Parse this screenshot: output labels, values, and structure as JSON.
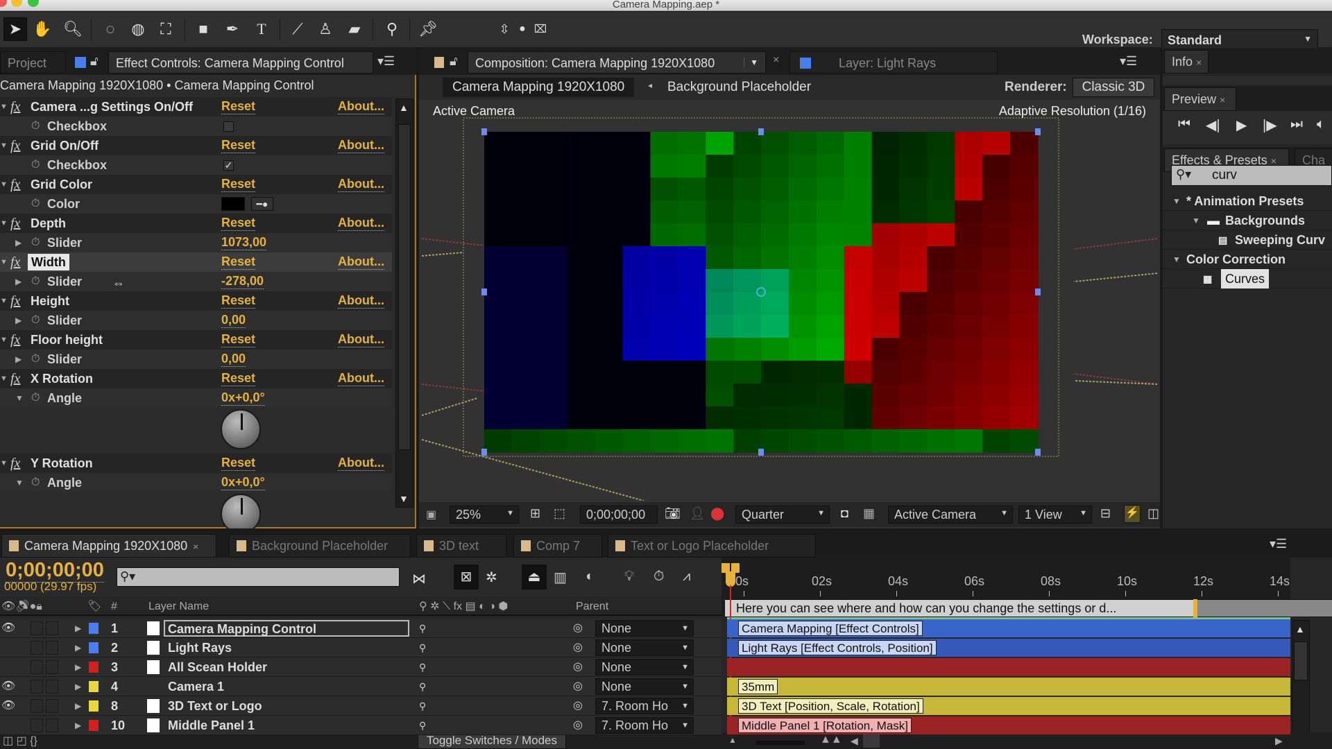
{
  "window": {
    "title": "Camera Mapping.aep *"
  },
  "toolbar": {
    "tools": [
      "selection-tool",
      "hand-tool",
      "zoom-tool",
      "rotation-tool",
      "orbit-camera-tool",
      "track-xy-camera-tool",
      "rectangle-tool",
      "pen-tool",
      "type-tool",
      "brush-tool",
      "clone-stamp-tool",
      "eraser-tool",
      "roto-brush-tool",
      "puppet-pin-tool"
    ],
    "workspace_label": "Workspace:",
    "workspace_value": "Standard"
  },
  "effect_controls": {
    "tab_project": "Project",
    "tab_title": "Effect Controls: Camera Mapping Control",
    "breadcrumb": "Camera Mapping 1920X1080 • Camera Mapping Control",
    "reset_label": "Reset",
    "about_label": "About...",
    "effects": [
      {
        "name": "Camera ...g Settings On/Off",
        "param": "Checkbox",
        "type": "checkbox",
        "checked": false
      },
      {
        "name": "Grid On/Off",
        "param": "Checkbox",
        "type": "checkbox",
        "checked": true
      },
      {
        "name": "Grid Color",
        "param": "Color",
        "type": "color",
        "color": "#000000"
      },
      {
        "name": "Depth",
        "param": "Slider",
        "type": "slider",
        "value": "1073,00"
      },
      {
        "name": "Width",
        "param": "Slider",
        "type": "slider",
        "value": "-278,00",
        "selected": true
      },
      {
        "name": "Height",
        "param": "Slider",
        "type": "slider",
        "value": "0,00"
      },
      {
        "name": "Floor height",
        "param": "Slider",
        "type": "slider",
        "value": "0,00"
      },
      {
        "name": "X Rotation",
        "param": "Angle",
        "type": "angle",
        "value": "0x+0,0°"
      },
      {
        "name": "Y Rotation",
        "param": "Angle",
        "type": "angle",
        "value": "0x+0,0°"
      }
    ]
  },
  "composition": {
    "tab_title": "Composition: Camera Mapping 1920X1080",
    "layer_tab": "Layer: Light Rays",
    "flow_current": "Camera Mapping 1920X1080",
    "flow_next": "Background Placeholder",
    "renderer_label": "Renderer:",
    "renderer_value": "Classic 3D",
    "view_label": "Active Camera",
    "adaptive_label": "Adaptive Resolution (1/16)",
    "zoom": "25%",
    "timecode": "0;00;00;00",
    "resolution": "Quarter",
    "camera_view": "Active Camera",
    "views": "1 View"
  },
  "right_panels": {
    "info_tab": "Info",
    "preview_tab": "Preview",
    "effects_tab": "Effects & Presets",
    "char_tab": "Cha",
    "search_value": "curv",
    "tree": [
      {
        "label": "* Animation Presets",
        "level": 0,
        "expanded": true
      },
      {
        "label": "Backgrounds",
        "level": 1,
        "expanded": true,
        "icon": "folder"
      },
      {
        "label": "Sweeping Curv",
        "level": 2,
        "icon": "preset"
      },
      {
        "label": "Color Correction",
        "level": 0,
        "expanded": true
      },
      {
        "label": "Curves",
        "level": 1,
        "icon": "effect-32",
        "selected": true
      }
    ]
  },
  "timeline": {
    "tabs": [
      {
        "label": "Camera Mapping 1920X1080",
        "active": true
      },
      {
        "label": "Background Placeholder"
      },
      {
        "label": "3D text"
      },
      {
        "label": "Comp 7"
      },
      {
        "label": "Text or Logo Placeholder"
      }
    ],
    "timecode": "0;00;00;00",
    "frame_info": "00000 (29.97 fps)",
    "col_num": "#",
    "col_layer_name": "Layer Name",
    "col_parent": "Parent",
    "ruler": [
      "0s",
      "02s",
      "04s",
      "06s",
      "08s",
      "10s",
      "12s",
      "14s"
    ],
    "comment": "Here you can see where and how can you change the settings or d...",
    "layers": [
      {
        "num": "1",
        "name": "Camera Mapping Control",
        "label_color": "#4a7ef0",
        "parent": "None",
        "bar_color": "#3a64c8",
        "bar_label": "Camera Mapping [Effect Controls]",
        "visible": true,
        "selected": true
      },
      {
        "num": "2",
        "name": "Light Rays",
        "label_color": "#4a7ef0",
        "parent": "None",
        "bar_color": "#3658b8",
        "bar_label": "Light Rays [Effect Controls, Position]",
        "visible": false
      },
      {
        "num": "3",
        "name": "All Scean Holder",
        "label_color": "#d02020",
        "parent": "None",
        "bar_color": "#9a2424",
        "bar_label": "",
        "visible": false
      },
      {
        "num": "4",
        "name": "Camera 1",
        "label_color": "#e8d840",
        "parent": "None",
        "bar_color": "#c8b838",
        "bar_label": "35mm",
        "visible": true
      },
      {
        "num": "8",
        "name": "3D Text or Logo",
        "label_color": "#e8d840",
        "parent": "7. Room Ho",
        "bar_color": "#c8b838",
        "bar_label": "3D Text [Position, Scale, Rotation]",
        "visible": true
      },
      {
        "num": "10",
        "name": "Middle Panel 1",
        "label_color": "#d02020",
        "parent": "7. Room Ho",
        "bar_color": "#9a2424",
        "bar_label": "Middle Panel 1 [Rotation, Mask]",
        "visible": false
      }
    ],
    "toggle_label": "Toggle Switches / Modes"
  }
}
